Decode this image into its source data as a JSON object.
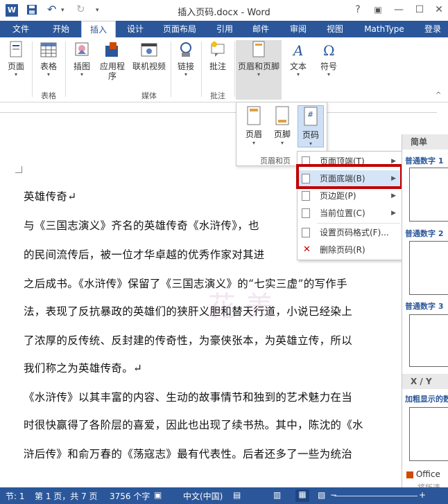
{
  "window": {
    "title": "插入页码.docx - Word",
    "help": "?",
    "ribbon_display": "▣",
    "minimize": "—",
    "restore": "☐",
    "close": "✕"
  },
  "tabs": [
    "文件",
    "开始",
    "插入",
    "设计",
    "页面布局",
    "引用",
    "邮件",
    "审阅",
    "视图",
    "MathType",
    "登录"
  ],
  "ribbon": {
    "page": "页面",
    "table": "表格",
    "table_group": "表格",
    "picture": "插图",
    "apps": "应用程\n序",
    "online_video": "联机视频",
    "media_group": "媒体",
    "link": "链接",
    "comment": "批注",
    "comment_group": "批注",
    "header_footer": "页眉和页脚",
    "text": "文本",
    "symbol": "符号"
  },
  "hf_panel": {
    "header": "页眉",
    "footer": "页脚",
    "page_number": "页码",
    "group_label": "页眉和页"
  },
  "page_number_menu": {
    "items": [
      {
        "label": "页面顶端(T)",
        "arrow": "▶"
      },
      {
        "label": "页面底端(B)",
        "arrow": "▶"
      },
      {
        "label": "页边距(P)",
        "arrow": "▶"
      },
      {
        "label": "当前位置(C)",
        "arrow": "▶"
      },
      {
        "label": "设置页码格式(F)...",
        "arrow": ""
      },
      {
        "label": "删除页码(R)",
        "arrow": ""
      }
    ]
  },
  "gallery": {
    "head_simple": "简单",
    "item1": "普通数字 1",
    "item2": "普通数字 2",
    "item3": "普通数字 3",
    "head_xy": "X / Y",
    "item_bold": "加粗显示的数",
    "office": "Office",
    "more": "将所选"
  },
  "document": {
    "lines": [
      "英雄传奇↵",
      "与《三国志演义》齐名的英雄传奇《水浒传》，也",
      "的民间流传后，被一位才华卓越的优秀作家对其进",
      "之后成书。《水浒传》保留了《三国志演义》的“七实三虚”的写作手",
      "法，表现了反抗暴政的英雄们的狭肝义胆和替天行道，小说已经染上",
      "了浓厚的反传统、反封建的传奇性，为豪侠张本，为英雄立传，所以",
      "我们称之为英雄传奇。↵",
      "《水浒传》以其丰富的内容、生动的故事情节和独到的艺术魅力在当",
      "时很快赢得了各阶层的喜爱，因此也出现了续书热。其中，陈沈的《水",
      "浒后传》和俞万春的《荡寇志》最有代表性。后者还多了一些为统治"
    ],
    "watermark": "花美"
  },
  "status": {
    "section": "节: 1",
    "page": "第 1 页，共 7 页",
    "words": "3756 个字",
    "language": "中文(中国)"
  },
  "colors": {
    "accent": "#2b579a",
    "highlight": "#c00000"
  }
}
